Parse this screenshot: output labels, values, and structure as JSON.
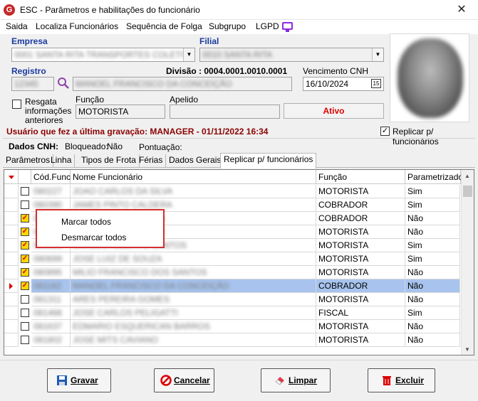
{
  "window": {
    "title": "ESC - Parâmetros e habilitações do funcionário",
    "close": "✕"
  },
  "menu": {
    "items": [
      "Saida",
      "Localiza Funcionários",
      "Sequência de Folga",
      "Subgrupo",
      "LGPD"
    ]
  },
  "form": {
    "empresa_label": "Empresa",
    "empresa_value": "0001 SANTA RITA TRANSPORTES COLETIVOS",
    "filial_label": "Filial",
    "filial_value": "0010 SANTA RITA",
    "registro_label": "Registro",
    "registro_value": "12345",
    "nome_value": "MANOEL FRANCISCO DA CONCEIÇÃO",
    "divisao_text": "Divisão : 0004.0001.0010.0001",
    "vencimento_label": "Vencimento  CNH",
    "vencimento_value": "16/10/2024",
    "calendar_icon": "15",
    "resgata_label": "Resgata informações anteriores",
    "funcao_label": "Função",
    "funcao_value": "MOTORISTA",
    "apelido_label": "Apelido",
    "apelido_value": "",
    "status_button": "Ativo",
    "ultima_gravacao": "Usuário que fez a última gravação: MANAGER - 01/11/2022 16:34",
    "replicar_label": "Replicar p/ funcionários",
    "replicar_checked": "✓"
  },
  "dados_cnh": {
    "label": "Dados CNH:",
    "bloqueado": "Bloqueado:",
    "bloqueado_value": "Não",
    "pontuacao": "Pontuação:"
  },
  "tabs": [
    "Parâmetros",
    "Linha",
    "Tipos de Frota",
    "Férias",
    "Dados Gerais",
    "Replicar p/ funcionários"
  ],
  "grid": {
    "headers": [
      "Cód.Func",
      "Nome Funcionário",
      "Função",
      "Parametrizado"
    ],
    "rows": [
      {
        "checked": "",
        "code": "080227",
        "name": "JOAO CARLOS DA SILVA",
        "funcao": "MOTORISTA",
        "param": "Sim"
      },
      {
        "checked": "",
        "code": "080390",
        "name": "JAMES PINTO CALDERA",
        "funcao": "COBRADOR",
        "param": "Sim"
      },
      {
        "checked": "✓",
        "code": "080412",
        "name": "ANTONIO SOUZA LIMA",
        "funcao": "COBRADOR",
        "param": "Não"
      },
      {
        "checked": "✓",
        "code": "080455",
        "name": "PAULO RIBEIRO NETO",
        "funcao": "MOTORISTA",
        "param": "Não"
      },
      {
        "checked": "✓",
        "code": "080521",
        "name": "CARLOS ALBERTO SANTOS",
        "funcao": "MOTORISTA",
        "param": "Sim"
      },
      {
        "checked": "✓",
        "code": "080699",
        "name": "JOSE LUIZ DE SOUZA",
        "funcao": "MOTORISTA",
        "param": "Sim"
      },
      {
        "checked": "✓",
        "code": "080895",
        "name": "MILIO FRANCISCO DOS SANTOS",
        "funcao": "MOTORISTA",
        "param": "Não"
      },
      {
        "checked": "✓",
        "code": "081162",
        "name": "MANOEL FRANCISCO DA CONCEIÇÃO",
        "funcao": "COBRADOR",
        "param": "Não"
      },
      {
        "checked": "",
        "code": "081311",
        "name": "ARES PEREIRA GOMES",
        "funcao": "MOTORISTA",
        "param": "Não"
      },
      {
        "checked": "",
        "code": "081466",
        "name": "JOSE CARLOS PELIGATTI",
        "funcao": "FISCAL",
        "param": "Sim"
      },
      {
        "checked": "",
        "code": "081637",
        "name": "EDMARIO ESQUERICAN BARROS",
        "funcao": "MOTORISTA",
        "param": "Não"
      },
      {
        "checked": "",
        "code": "081802",
        "name": "JOSE MITS CAVIANO",
        "funcao": "MOTORISTA",
        "param": "Não"
      }
    ]
  },
  "context_menu": {
    "items": [
      "Marcar todos",
      "Desmarcar todos"
    ]
  },
  "buttons": {
    "gravar": "Gravar",
    "cancelar": "Cancelar",
    "limpar": "Limpar",
    "excluir": "Excluir"
  },
  "colors": {
    "accent_blue": "#1a3aa0",
    "danger": "#d32f2f",
    "selected_row": "#a8c4ee"
  }
}
